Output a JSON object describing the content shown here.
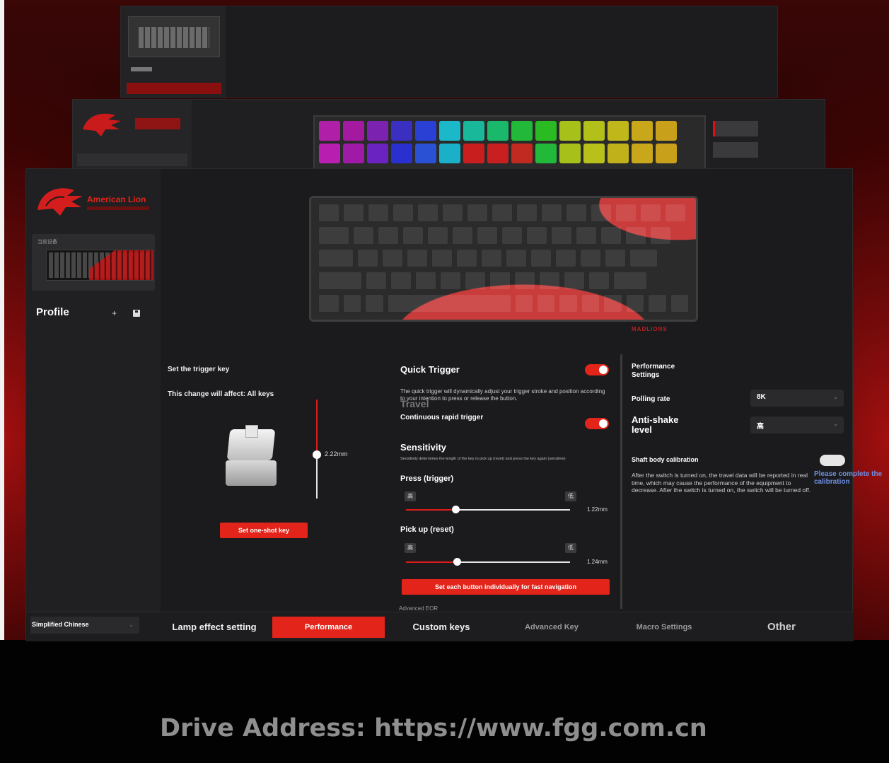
{
  "brand": {
    "name": "American Lion",
    "keyboard_brand": "MADLIONS",
    "accent": "#e3241b"
  },
  "sidebar": {
    "device_caption": "当前设备",
    "profile_label": "Profile",
    "add_icon": "plus-icon",
    "save_icon": "save-icon",
    "language": "Simplified Chinese"
  },
  "trigger": {
    "title": "Set the trigger key",
    "affect": "This change will affect: All keys",
    "travel_value": "2.22mm",
    "oneshot_button": "Set one-shot key"
  },
  "quick_trigger": {
    "title": "Quick Trigger",
    "enabled": true,
    "description": "The quick trigger will dynamically adjust your trigger stroke and position according to your intention to press or release the button.",
    "travel_label": "Travel",
    "continuous_label": "Continuous rapid trigger",
    "continuous_enabled": true,
    "sensitivity_title": "Sensitivity",
    "sensitivity_desc": "Sensitivity determines the length of the key to pick up (reset) and press the key again (sensitive)",
    "press_label": "Press (trigger)",
    "press_value": "1.22mm",
    "press_fraction": 0.3,
    "pickup_label": "Pick up (reset)",
    "pickup_value": "1.24mm",
    "pickup_fraction": 0.31,
    "icon_low": "高",
    "icon_high": "低",
    "fastnav_button": "Set each button individually for fast navigation",
    "advanced_eor": "Advanced EOR"
  },
  "performance": {
    "title": "Performance Settings",
    "polling_label": "Polling rate",
    "polling_value": "8K",
    "antishake_label": "Anti-shake level",
    "antishake_value": "高",
    "calibration_label": "Shaft body calibration",
    "calibration_enabled": false,
    "calibration_desc": "After the switch is turned on, the travel data will be reported in real time, which may cause the performance of the equipment to decrease. After the switch is turned on, the switch will be turned off.",
    "calibration_prompt": "Please complete the calibration"
  },
  "tabs": [
    {
      "label": "Lamp effect setting"
    },
    {
      "label": "Performance"
    },
    {
      "label": "Custom keys"
    },
    {
      "label": "Advanced Key"
    },
    {
      "label": "Macro Settings"
    },
    {
      "label": "Other"
    }
  ],
  "active_tab": "Performance",
  "footer": {
    "drive_address": "Drive Address: https://www.fgg.com.cn"
  }
}
